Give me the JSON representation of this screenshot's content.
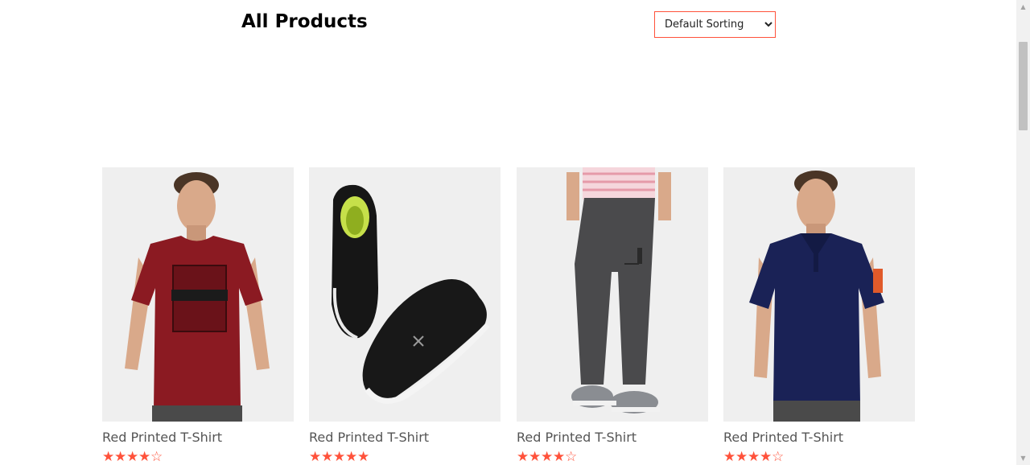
{
  "header": {
    "title": "All Products",
    "sort_selected": "Default Sorting"
  },
  "products": [
    {
      "name": "Red Printed T-Shirt",
      "rating": 4,
      "image": "red-tshirt"
    },
    {
      "name": "Red Printed T-Shirt",
      "rating": 5,
      "image": "black-shoes"
    },
    {
      "name": "Red Printed T-Shirt",
      "rating": 4,
      "image": "grey-trousers"
    },
    {
      "name": "Red Printed T-Shirt",
      "rating": 4,
      "image": "navy-polo"
    }
  ],
  "colors": {
    "accent": "#ff523b",
    "card_bg": "#efefef"
  },
  "icons": {
    "star_full": "star-icon",
    "star_empty": "star-outline-icon",
    "scroll_up": "chevron-up-icon",
    "scroll_down": "chevron-down-icon"
  }
}
